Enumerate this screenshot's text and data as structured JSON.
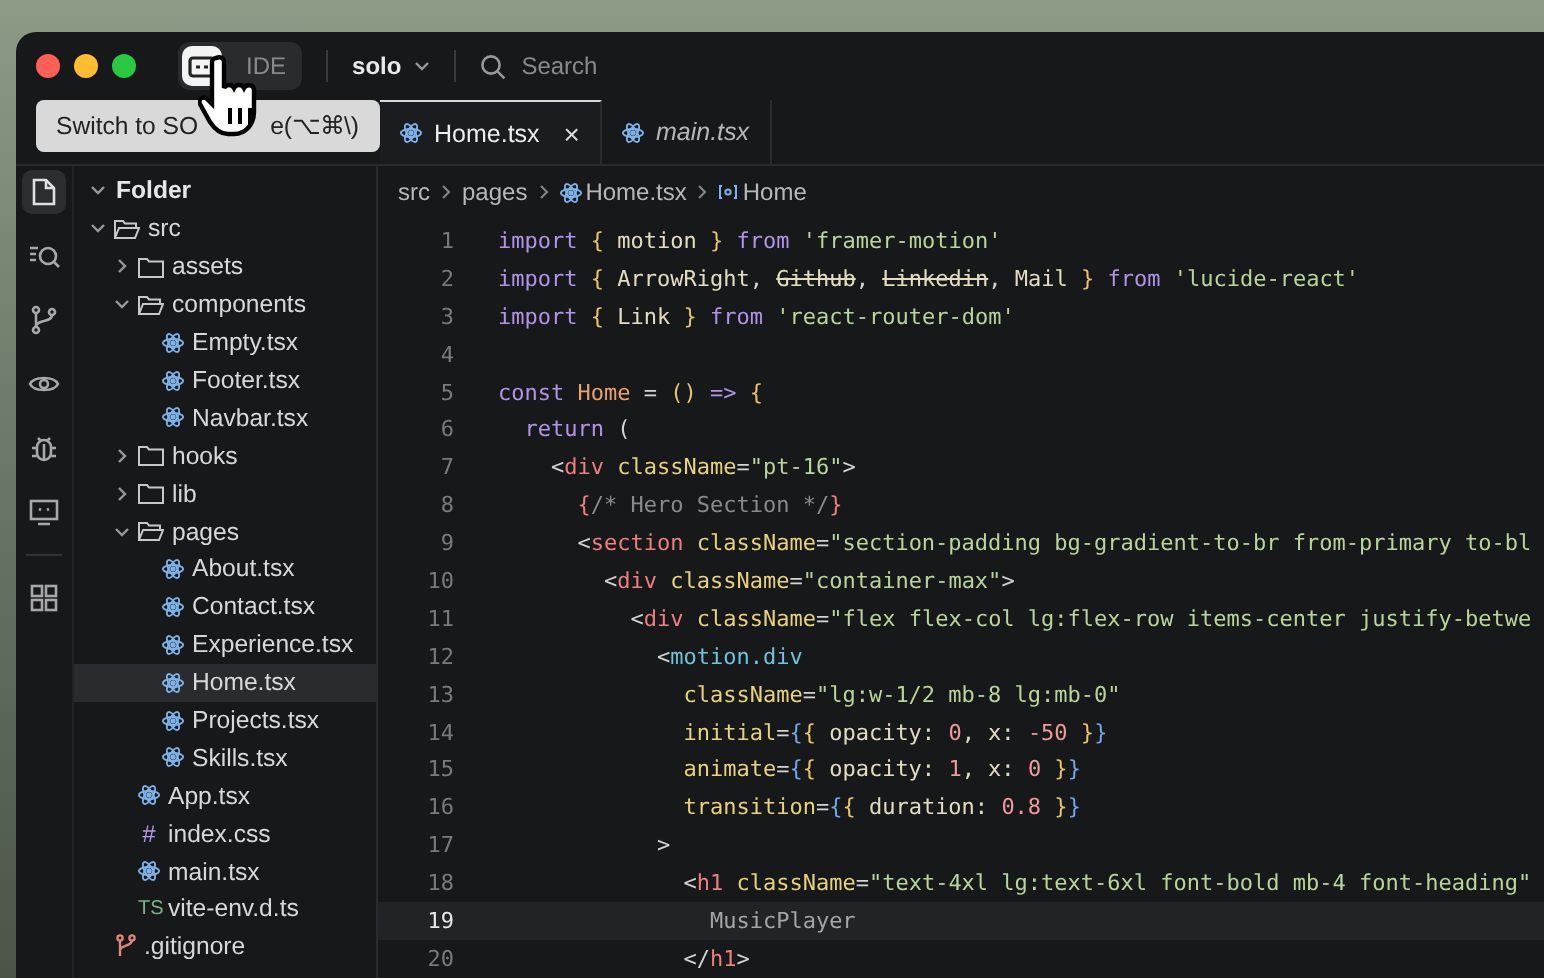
{
  "titlebar": {
    "mode_toggle": {
      "label": "IDE",
      "icon_selected": true
    },
    "workspace": "solo",
    "search": {
      "placeholder": "Search"
    }
  },
  "tooltip": {
    "text_before": "Switch to SO",
    "text_after": "e(⌥⌘\\)"
  },
  "activity_bar": [
    {
      "selected": true
    },
    {
      "selected": false
    },
    {
      "selected": false
    },
    {
      "selected": false
    },
    {
      "selected": false
    },
    {
      "selected": false
    },
    {
      "selected": false
    }
  ],
  "explorer": {
    "title": "Folder",
    "expanded": true,
    "tree": [
      {
        "name": "src",
        "kind": "folder",
        "expanded": true,
        "selected": false,
        "children": [
          {
            "name": "assets",
            "kind": "folder",
            "expanded": false,
            "selected": false
          },
          {
            "name": "components",
            "kind": "folder",
            "expanded": true,
            "selected": false,
            "children": [
              {
                "name": "Empty.tsx",
                "kind": "react",
                "selected": false
              },
              {
                "name": "Footer.tsx",
                "kind": "react",
                "selected": false
              },
              {
                "name": "Navbar.tsx",
                "kind": "react",
                "selected": false
              }
            ]
          },
          {
            "name": "hooks",
            "kind": "folder",
            "expanded": false,
            "selected": false
          },
          {
            "name": "lib",
            "kind": "folder",
            "expanded": false,
            "selected": false
          },
          {
            "name": "pages",
            "kind": "folder",
            "expanded": true,
            "selected": false,
            "children": [
              {
                "name": "About.tsx",
                "kind": "react",
                "selected": false
              },
              {
                "name": "Contact.tsx",
                "kind": "react",
                "selected": false
              },
              {
                "name": "Experience.tsx",
                "kind": "react",
                "selected": false
              },
              {
                "name": "Home.tsx",
                "kind": "react",
                "selected": true
              },
              {
                "name": "Projects.tsx",
                "kind": "react",
                "selected": false
              },
              {
                "name": "Skills.tsx",
                "kind": "react",
                "selected": false
              }
            ]
          },
          {
            "name": "App.tsx",
            "kind": "react",
            "selected": false
          },
          {
            "name": "index.css",
            "kind": "css",
            "icon_text": "#",
            "selected": false
          },
          {
            "name": "main.tsx",
            "kind": "react",
            "selected": false
          },
          {
            "name": "vite-env.d.ts",
            "kind": "ts",
            "icon_text": "TS",
            "selected": false
          }
        ]
      },
      {
        "name": ".gitignore",
        "kind": "git",
        "selected": false
      }
    ]
  },
  "tabs": [
    {
      "label": "Home.tsx",
      "selected": true,
      "preview": false,
      "close": "×"
    },
    {
      "label": "main.tsx",
      "selected": false,
      "preview": true
    }
  ],
  "breadcrumb": [
    {
      "label": "src",
      "kind": "folder"
    },
    {
      "label": "pages",
      "kind": "folder"
    },
    {
      "label": "Home.tsx",
      "kind": "react"
    },
    {
      "label": "Home",
      "kind": "symbol"
    }
  ],
  "code": [
    {
      "number": "1",
      "current": false,
      "tokens": [
        {
          "text": "import",
          "kind": "kw"
        },
        {
          "text": " {",
          "kind": "brace"
        },
        {
          "text": " motion",
          "kind": "ident"
        },
        {
          "text": " }",
          "kind": "brace"
        },
        {
          "text": " from",
          "kind": "kw"
        },
        {
          "text": " 'framer-motion'",
          "kind": "str"
        }
      ]
    },
    {
      "number": "2",
      "current": false,
      "tokens": [
        {
          "text": "import",
          "kind": "kw"
        },
        {
          "text": " {",
          "kind": "brace"
        },
        {
          "text": " ArrowRight",
          "kind": "ident"
        },
        {
          "text": ", ",
          "kind": "punct"
        },
        {
          "text": "Github",
          "kind": "dep"
        },
        {
          "text": ", ",
          "kind": "punct"
        },
        {
          "text": "Linkedin",
          "kind": "dep"
        },
        {
          "text": ",",
          "kind": "punct"
        },
        {
          "text": " Mail",
          "kind": "ident"
        },
        {
          "text": " }",
          "kind": "brace"
        },
        {
          "text": " from",
          "kind": "kw"
        },
        {
          "text": " 'lucide-react'",
          "kind": "str"
        }
      ]
    },
    {
      "number": "3",
      "current": false,
      "tokens": [
        {
          "text": "import",
          "kind": "kw"
        },
        {
          "text": " {",
          "kind": "brace"
        },
        {
          "text": " Link",
          "kind": "ident"
        },
        {
          "text": " }",
          "kind": "brace"
        },
        {
          "text": " from",
          "kind": "kw"
        },
        {
          "text": " 'react-router-dom'",
          "kind": "str"
        }
      ]
    },
    {
      "number": "4",
      "current": false
    },
    {
      "number": "5",
      "current": false,
      "tokens": [
        {
          "text": "const",
          "kind": "kw"
        },
        {
          "text": " Home",
          "kind": "name"
        },
        {
          "text": " =",
          "kind": "punct"
        },
        {
          "text": " ()",
          "kind": "brace"
        },
        {
          "text": " =>",
          "kind": "kw"
        },
        {
          "text": " {",
          "kind": "brace"
        }
      ]
    },
    {
      "number": "6",
      "current": false,
      "tokens": [
        {
          "text": "  return",
          "kind": "kw"
        },
        {
          "text": " (",
          "kind": "punct"
        }
      ]
    },
    {
      "number": "7",
      "current": false,
      "tokens": [
        {
          "text": "    <",
          "kind": "punct"
        },
        {
          "text": "div",
          "kind": "tag"
        },
        {
          "text": " className",
          "kind": "attr"
        },
        {
          "text": "=",
          "kind": "punct"
        },
        {
          "text": "\"pt-16\"",
          "kind": "str"
        },
        {
          "text": ">",
          "kind": "punct"
        }
      ]
    },
    {
      "number": "8",
      "current": false,
      "tokens": [
        {
          "text": "      {",
          "kind": "tag"
        },
        {
          "text": "/* Hero Section */",
          "kind": "comment"
        },
        {
          "text": "}",
          "kind": "tag"
        }
      ]
    },
    {
      "number": "9",
      "current": false,
      "tokens": [
        {
          "text": "      <",
          "kind": "punct"
        },
        {
          "text": "section",
          "kind": "tag"
        },
        {
          "text": " className",
          "kind": "attr"
        },
        {
          "text": "=",
          "kind": "punct"
        },
        {
          "text": "\"section-padding bg-gradient-to-br from-primary to-bl",
          "kind": "str"
        }
      ]
    },
    {
      "number": "10",
      "current": false,
      "tokens": [
        {
          "text": "        <",
          "kind": "punct"
        },
        {
          "text": "div",
          "kind": "tag"
        },
        {
          "text": " className",
          "kind": "attr"
        },
        {
          "text": "=",
          "kind": "punct"
        },
        {
          "text": "\"container-max\"",
          "kind": "str"
        },
        {
          "text": ">",
          "kind": "punct"
        }
      ]
    },
    {
      "number": "11",
      "current": false,
      "tokens": [
        {
          "text": "          <",
          "kind": "punct"
        },
        {
          "text": "div",
          "kind": "tag"
        },
        {
          "text": " className",
          "kind": "attr"
        },
        {
          "text": "=",
          "kind": "punct"
        },
        {
          "text": "\"flex flex-col lg:flex-row items-center justify-betwe",
          "kind": "str"
        }
      ]
    },
    {
      "number": "12",
      "current": false,
      "tokens": [
        {
          "text": "            <",
          "kind": "punct"
        },
        {
          "text": "motion.div",
          "kind": "comp"
        }
      ]
    },
    {
      "number": "13",
      "current": false,
      "tokens": [
        {
          "text": "              className",
          "kind": "attr"
        },
        {
          "text": "=",
          "kind": "punct"
        },
        {
          "text": "\"lg:w-1/2 mb-8 lg:mb-0\"",
          "kind": "str"
        }
      ]
    },
    {
      "number": "14",
      "current": false,
      "tokens": [
        {
          "text": "              initial",
          "kind": "attr"
        },
        {
          "text": "=",
          "kind": "punct"
        },
        {
          "text": "{",
          "kind": "jsx"
        },
        {
          "text": "{",
          "kind": "brace"
        },
        {
          "text": " opacity: ",
          "kind": "ident"
        },
        {
          "text": "0",
          "kind": "num"
        },
        {
          "text": ", x: ",
          "kind": "ident"
        },
        {
          "text": "-50",
          "kind": "num"
        },
        {
          "text": " }",
          "kind": "brace"
        },
        {
          "text": "}",
          "kind": "jsx"
        }
      ]
    },
    {
      "number": "15",
      "current": false,
      "tokens": [
        {
          "text": "              animate",
          "kind": "attr"
        },
        {
          "text": "=",
          "kind": "punct"
        },
        {
          "text": "{",
          "kind": "jsx"
        },
        {
          "text": "{",
          "kind": "brace"
        },
        {
          "text": " opacity: ",
          "kind": "ident"
        },
        {
          "text": "1",
          "kind": "num"
        },
        {
          "text": ", x: ",
          "kind": "ident"
        },
        {
          "text": "0",
          "kind": "num"
        },
        {
          "text": " }",
          "kind": "brace"
        },
        {
          "text": "}",
          "kind": "jsx"
        }
      ]
    },
    {
      "number": "16",
      "current": false,
      "tokens": [
        {
          "text": "              transition",
          "kind": "attr"
        },
        {
          "text": "=",
          "kind": "punct"
        },
        {
          "text": "{",
          "kind": "jsx"
        },
        {
          "text": "{",
          "kind": "brace"
        },
        {
          "text": " duration: ",
          "kind": "ident"
        },
        {
          "text": "0.8",
          "kind": "num"
        },
        {
          "text": " }",
          "kind": "brace"
        },
        {
          "text": "}",
          "kind": "jsx"
        }
      ]
    },
    {
      "number": "17",
      "current": false,
      "tokens": [
        {
          "text": "            >",
          "kind": "punct"
        }
      ]
    },
    {
      "number": "18",
      "current": false,
      "tokens": [
        {
          "text": "              <",
          "kind": "punct"
        },
        {
          "text": "h1",
          "kind": "tag"
        },
        {
          "text": " className",
          "kind": "attr"
        },
        {
          "text": "=",
          "kind": "punct"
        },
        {
          "text": "\"text-4xl lg:text-6xl font-bold mb-4 font-heading\"",
          "kind": "str"
        }
      ]
    },
    {
      "number": "19",
      "current": true,
      "tokens": [
        {
          "text": "                MusicPlayer",
          "kind": "text"
        }
      ]
    },
    {
      "number": "20",
      "current": false,
      "tokens": [
        {
          "text": "              </",
          "kind": "punct"
        },
        {
          "text": "h1",
          "kind": "tag"
        },
        {
          "text": ">",
          "kind": "punct"
        }
      ]
    }
  ]
}
